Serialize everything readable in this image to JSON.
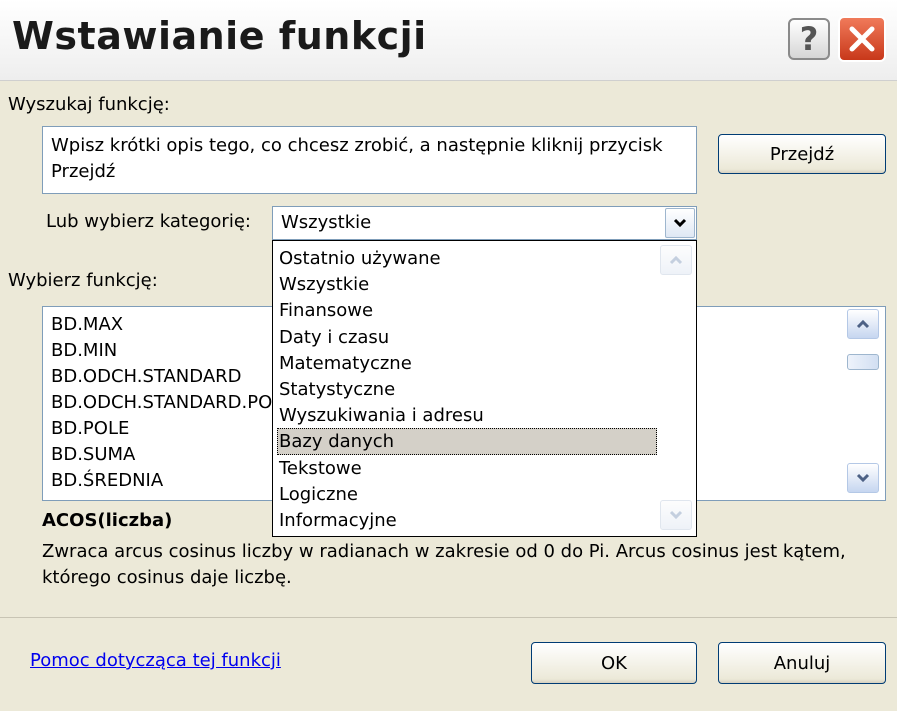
{
  "window": {
    "title": "Wstawianie funkcji",
    "help_label": "?"
  },
  "search": {
    "label": "Wyszukaj funkcję:",
    "value": "Wpisz krótki opis tego, co chcesz zrobić, a następnie kliknij przycisk Przejdź",
    "go_button": "Przejdź"
  },
  "category": {
    "label": "Lub wybierz kategorię:",
    "selected": "Wszystkie",
    "options": [
      "Ostatnio używane",
      "Wszystkie",
      "Finansowe",
      "Daty i czasu",
      "Matematyczne",
      "Statystyczne",
      "Wyszukiwania i adresu",
      "Bazy danych",
      "Tekstowe",
      "Logiczne",
      "Informacyjne"
    ],
    "highlighted_option": "Bazy danych"
  },
  "functions": {
    "label": "Wybierz funkcję:",
    "items": [
      "BD.MAX",
      "BD.MIN",
      "BD.ODCH.STANDARD",
      "BD.ODCH.STANDARD.POPUL",
      "BD.POLE",
      "BD.SUMA",
      "BD.ŚREDNIA"
    ]
  },
  "details": {
    "signature": "ACOS(liczba)",
    "description": "Zwraca arcus cosinus liczby w radianach w zakresie od 0 do Pi. Arcus cosinus jest kątem, którego cosinus daje liczbę."
  },
  "footer": {
    "help_link": "Pomoc dotycząca tej funkcji",
    "ok_button": "OK",
    "cancel_button": "Anuluj"
  },
  "icons": {
    "close": "close-icon",
    "help": "help-icon",
    "combo_arrow": "chevron-down-icon",
    "scroll_up": "chevron-up-icon",
    "scroll_down": "chevron-down-icon"
  },
  "colors": {
    "dialog_bg": "#ece9d8",
    "close_red": "#d9452a",
    "link_blue": "#0000ee",
    "selected_row": "#d4d0c8"
  }
}
